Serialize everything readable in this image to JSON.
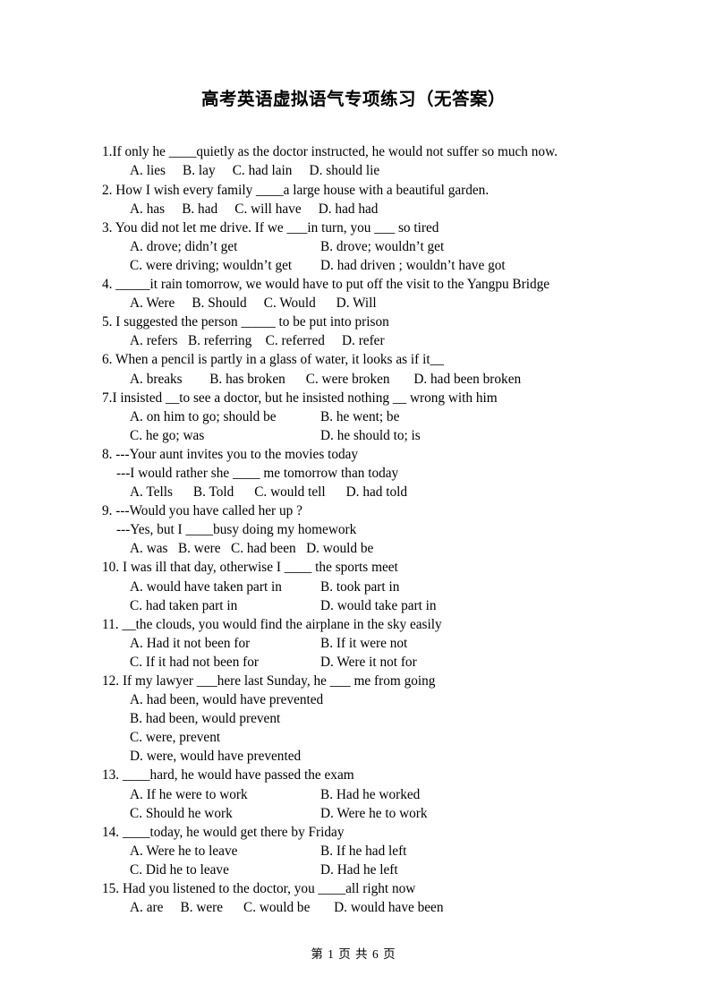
{
  "document": {
    "title": "高考英语虚拟语气专项练习（无答案）",
    "footer": "第 1 页 共 6 页"
  },
  "questions": [
    {
      "stem": "1.If only he ____quietly as the doctor instructed, he would not suffer so much now.",
      "layout": "inline",
      "options_inline": "A. lies     B. lay     C. had lain     D. should lie"
    },
    {
      "stem": "2. How I wish every family ____a large house with a beautiful garden.",
      "layout": "inline",
      "options_inline": "A. has     B. had     C. will have     D. had had"
    },
    {
      "stem": "3. You did not let me drive. If we ___in turn, you ___ so tired",
      "layout": "two-col",
      "rows": [
        {
          "left": "A. drove; didn’t get",
          "right": "B. drove; wouldn’t get"
        },
        {
          "left": "C. were driving; wouldn’t get",
          "right": "D. had driven ; wouldn’t have got"
        }
      ]
    },
    {
      "stem": "4. _____it rain tomorrow, we would have to put off the visit to the Yangpu Bridge",
      "layout": "inline",
      "options_inline": "A. Were     B. Should     C. Would      D. Will"
    },
    {
      "stem": "5. I suggested the person _____ to be put into prison",
      "layout": "inline",
      "options_inline": "A. refers   B. referring    C. referred     D. refer"
    },
    {
      "stem": "6. When a pencil is partly in a glass of water, it looks as if it__",
      "layout": "inline",
      "options_inline": "A. breaks        B. has broken      C. were broken       D. had been broken"
    },
    {
      "stem": "7.I insisted __to see a doctor, but he insisted nothing __ wrong with him",
      "layout": "two-col",
      "rows": [
        {
          "left": "A. on him to go; should be",
          "right": "B. he went; be"
        },
        {
          "left": "C. he go; was",
          "right": "D. he should to; is"
        }
      ]
    },
    {
      "stem": "8. ---Your aunt invites you to the movies today",
      "stem2": "---I would rather she ____ me tomorrow than today",
      "layout": "inline",
      "options_inline": "A. Tells      B. Told      C. would tell      D. had told"
    },
    {
      "stem": "9. ---Would you have called her up ?",
      "stem2": "---Yes, but I ____busy doing my homework",
      "layout": "inline",
      "options_inline": "A. was   B. were   C. had been   D. would be"
    },
    {
      "stem": "10. I was ill that day, otherwise I ____ the sports meet",
      "layout": "two-col",
      "rows": [
        {
          "left": "A. would have taken part in",
          "right": "B. took part in"
        },
        {
          "left": "C. had taken part in",
          "right": "D. would take part in"
        }
      ]
    },
    {
      "stem": "11. __the clouds, you would find the airplane in the sky easily",
      "layout": "two-col",
      "rows": [
        {
          "left": "A. Had it not been for",
          "right": "B. If it were not"
        },
        {
          "left": "C. If it had not been for",
          "right": "D. Were it not for"
        }
      ]
    },
    {
      "stem": "12. If my lawyer ___here last Sunday, he ___ me from going",
      "layout": "stacked",
      "stacked": [
        "A. had been, would have prevented",
        "B. had been, would prevent",
        "C. were, prevent",
        "D. were, would have prevented"
      ]
    },
    {
      "stem": "13. ____hard, he would have passed the exam",
      "layout": "two-col",
      "rows": [
        {
          "left": "A. If he were to work",
          "right": "B. Had he worked"
        },
        {
          "left": "C. Should he work",
          "right": "D. Were he to work"
        }
      ]
    },
    {
      "stem": "14. ____today, he would get there by Friday",
      "layout": "two-col",
      "rows": [
        {
          "left": "A. Were he to leave",
          "right": "B. If he had left"
        },
        {
          "left": "C. Did he to leave",
          "right": "D. Had he left"
        }
      ]
    },
    {
      "stem": "15. Had you listened to the doctor, you ____all right now",
      "layout": "inline",
      "options_inline": "A. are     B. were      C. would be       D. would have been"
    }
  ]
}
